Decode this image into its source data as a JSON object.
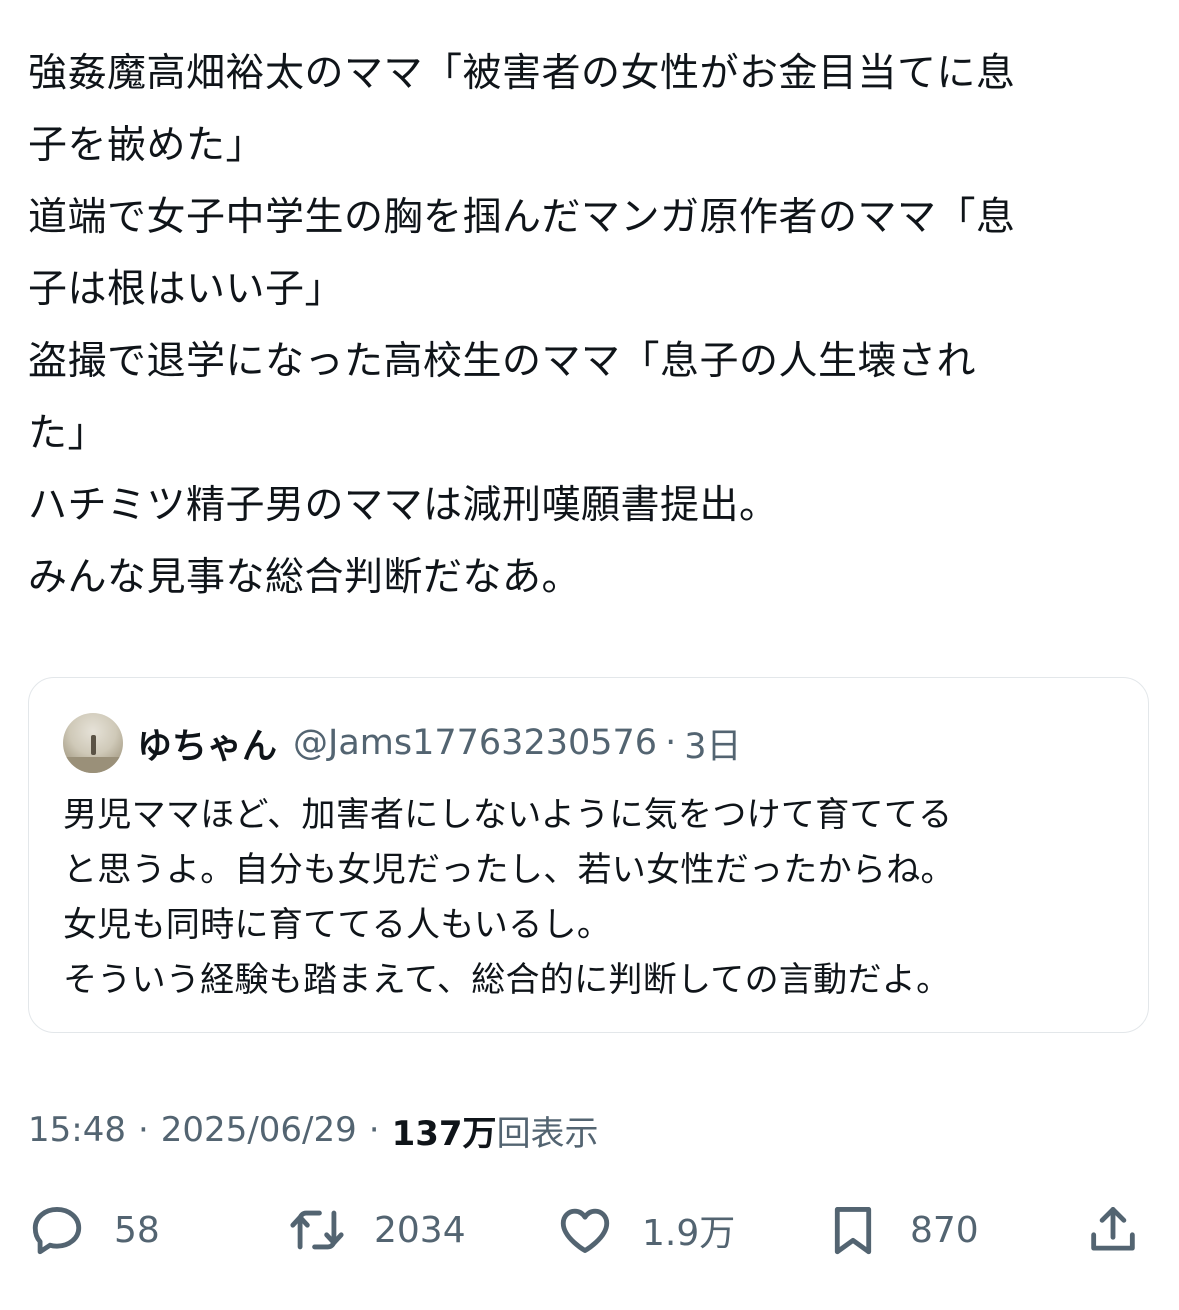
{
  "tweet": {
    "lines": [
      "強姦魔高畑裕太のママ「被害者の女性がお金目当てに息",
      "子を嵌めた」",
      "道端で女子中学生の胸を掴んだマンガ原作者のママ「息",
      "子は根はいい子」",
      "盗撮で退学になった高校生のママ「息子の人生壊され",
      "た」",
      "ハチミツ精子男のママは減刑嘆願書提出。",
      "みんな見事な総合判断だなあ。"
    ]
  },
  "quote": {
    "name": "ゆちゃん",
    "handle": "@Jams17763230576",
    "dot": "·",
    "time": "3日",
    "avatar_icon": "user-avatar",
    "lines": [
      "男児ママほど、加害者にしないように気をつけて育ててる",
      "と思うよ。自分も女児だったし、若い女性だったからね。",
      "女児も同時に育ててる人もいるし。",
      "そういう経験も踏まえて、総合的に判断しての言動だよ。"
    ]
  },
  "meta": {
    "time": "15:48",
    "sep1": "·",
    "date": "2025/06/29",
    "sep2": "·",
    "views_count": "137万",
    "views_label": "回表示"
  },
  "actions": {
    "reply": {
      "icon": "reply-icon",
      "count": "58"
    },
    "retweet": {
      "icon": "retweet-icon",
      "count": "2034"
    },
    "like": {
      "icon": "heart-icon",
      "count": "1.9万"
    },
    "bookmark": {
      "icon": "bookmark-icon",
      "count": "870"
    },
    "share": {
      "icon": "share-icon"
    }
  },
  "colors": {
    "text": "#0f1419",
    "secondary": "#536471",
    "border": "#e3e7ea"
  }
}
